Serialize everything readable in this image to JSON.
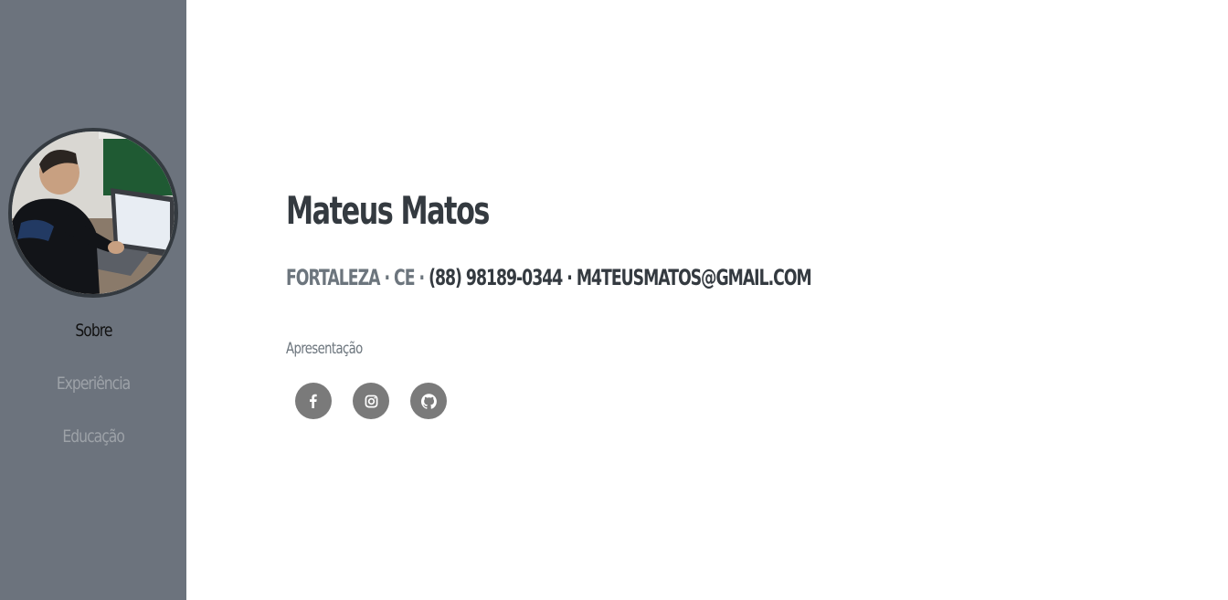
{
  "sidebar": {
    "avatar_alt": "profile-photo",
    "nav": [
      {
        "label": "Sobre",
        "active": true
      },
      {
        "label": "Experiência",
        "active": false
      },
      {
        "label": "Educação",
        "active": false
      }
    ]
  },
  "main": {
    "name": "Mateus Matos",
    "contact": {
      "city": "FORTALEZA · CE ·",
      "phone": "(88) 98189-0344",
      "separator": "·",
      "email": "M4TEUSMATOS@GMAIL.COM"
    },
    "presentation": "Apresentação",
    "social": [
      {
        "icon": "facebook-icon"
      },
      {
        "icon": "instagram-icon"
      },
      {
        "icon": "github-icon"
      }
    ]
  },
  "colors": {
    "sidebar_bg": "#6c737d",
    "heading": "#343a40",
    "muted": "#6c757d",
    "social_bg": "#7a7a7a"
  }
}
